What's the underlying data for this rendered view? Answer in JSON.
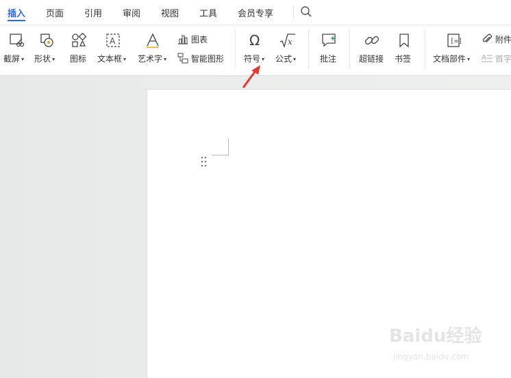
{
  "menubar": {
    "tabs": [
      {
        "label": "插入",
        "active": true
      },
      {
        "label": "页面"
      },
      {
        "label": "引用"
      },
      {
        "label": "审阅"
      },
      {
        "label": "视图"
      },
      {
        "label": "工具"
      },
      {
        "label": "会员专享"
      }
    ],
    "search_icon": "search-icon",
    "accent_color": "#2f6bd8"
  },
  "ribbon": {
    "screenshot": "截屏",
    "shape": "形状",
    "icon": "图标",
    "textbox": "文本框",
    "wordart": "艺术字",
    "chart": "图表",
    "smartart": "智能图形",
    "symbol": "符号",
    "formula": "公式",
    "comment": "批注",
    "hyperlink": "超链接",
    "bookmark": "书签",
    "doc_parts": "文档部件",
    "attachment": "附件",
    "dropcap": "首字"
  },
  "annotation": {
    "arrow_color": "#e8382f"
  },
  "watermark": {
    "logo": "Baidu经验",
    "url": "jingyan.baidu.com"
  }
}
